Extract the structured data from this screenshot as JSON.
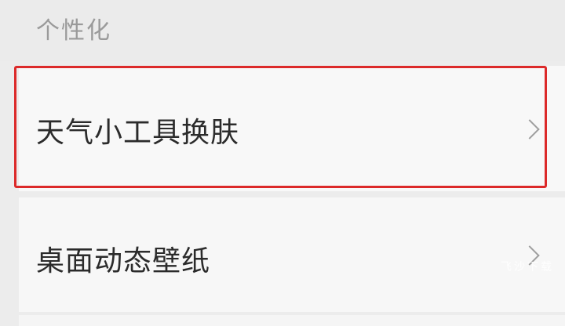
{
  "section": {
    "title": "个性化"
  },
  "items": [
    {
      "label": "天气小工具换肤",
      "icon": "chevron-right-icon"
    },
    {
      "label": "桌面动态壁纸",
      "icon": "chevron-right-icon"
    }
  ],
  "watermark": "飞沙下载",
  "colors": {
    "highlight_border": "#dc2a2a",
    "background": "#ececec",
    "row_background": "#f7f7f7",
    "section_title": "#9a9a9a",
    "label_text": "#2b2b2b"
  }
}
